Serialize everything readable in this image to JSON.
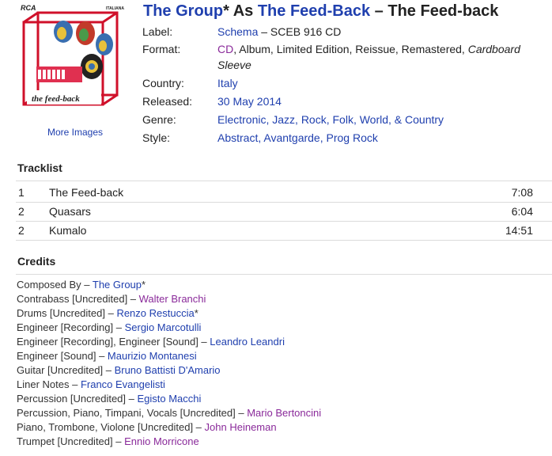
{
  "cover": {
    "label_top": "RCA",
    "label_right": "ITALIANA",
    "title_text": "the feed-back"
  },
  "more_images": "More Images",
  "title": {
    "artist": "The Group",
    "artist_suffix": "*",
    "as_text": " As ",
    "artist2": "The Feed-Back",
    "dash": " – ",
    "release": "The Feed-back"
  },
  "info": {
    "label_lab": "Label:",
    "label_link": "Schema",
    "label_rest": " – SCEB 916 CD",
    "format_lab": "Format:",
    "format_cd": "CD",
    "format_rest": ", Album, Limited Edition, Reissue, Remastered, ",
    "format_italic": "Cardboard Sleeve",
    "country_lab": "Country:",
    "country_val": "Italy",
    "released_lab": "Released:",
    "released_val": "30 May 2014",
    "genre_lab": "Genre:",
    "genre_val": "Electronic, Jazz, Rock, Folk, World, & Country",
    "style_lab": "Style:",
    "style_val": "Abstract, Avantgarde, Prog Rock"
  },
  "tracklist": {
    "heading": "Tracklist",
    "tracks": [
      {
        "pos": "1",
        "title": "The Feed-back",
        "duration": "7:08"
      },
      {
        "pos": "2",
        "title": "Quasars",
        "duration": "6:04"
      },
      {
        "pos": "2",
        "title": "Kumalo",
        "duration": "14:51"
      }
    ]
  },
  "credits": {
    "heading": "Credits",
    "items": [
      {
        "role": "Composed By – ",
        "name": "The Group",
        "suffix": "*",
        "visited": false
      },
      {
        "role": "Contrabass [Uncredited] – ",
        "name": "Walter Branchi",
        "suffix": "",
        "visited": true
      },
      {
        "role": "Drums [Uncredited] – ",
        "name": "Renzo Restuccia",
        "suffix": "*",
        "visited": false
      },
      {
        "role": "Engineer [Recording] – ",
        "name": "Sergio Marcotulli",
        "suffix": "",
        "visited": false
      },
      {
        "role": "Engineer [Recording], Engineer [Sound] – ",
        "name": "Leandro Leandri",
        "suffix": "",
        "visited": false
      },
      {
        "role": "Engineer [Sound] – ",
        "name": "Maurizio Montanesi",
        "suffix": "",
        "visited": false
      },
      {
        "role": "Guitar [Uncredited] – ",
        "name": "Bruno Battisti D'Amario",
        "suffix": "",
        "visited": false
      },
      {
        "role": "Liner Notes – ",
        "name": "Franco Evangelisti",
        "suffix": "",
        "visited": false
      },
      {
        "role": "Percussion [Uncredited] – ",
        "name": "Egisto Macchi",
        "suffix": "",
        "visited": false
      },
      {
        "role": "Percussion, Piano, Timpani, Vocals [Uncredited] – ",
        "name": "Mario Bertoncini",
        "suffix": "",
        "visited": true
      },
      {
        "role": "Piano, Trombone, Violone [Uncredited] – ",
        "name": "John Heineman",
        "suffix": "",
        "visited": true
      },
      {
        "role": "Trumpet [Uncredited] – ",
        "name": "Ennio Morricone",
        "suffix": "",
        "visited": true
      }
    ]
  },
  "colors": {
    "link": "#1f3fae",
    "visited": "#8a2a9a",
    "rule": "#dcdcdc",
    "cover_red": "#d0102a"
  }
}
